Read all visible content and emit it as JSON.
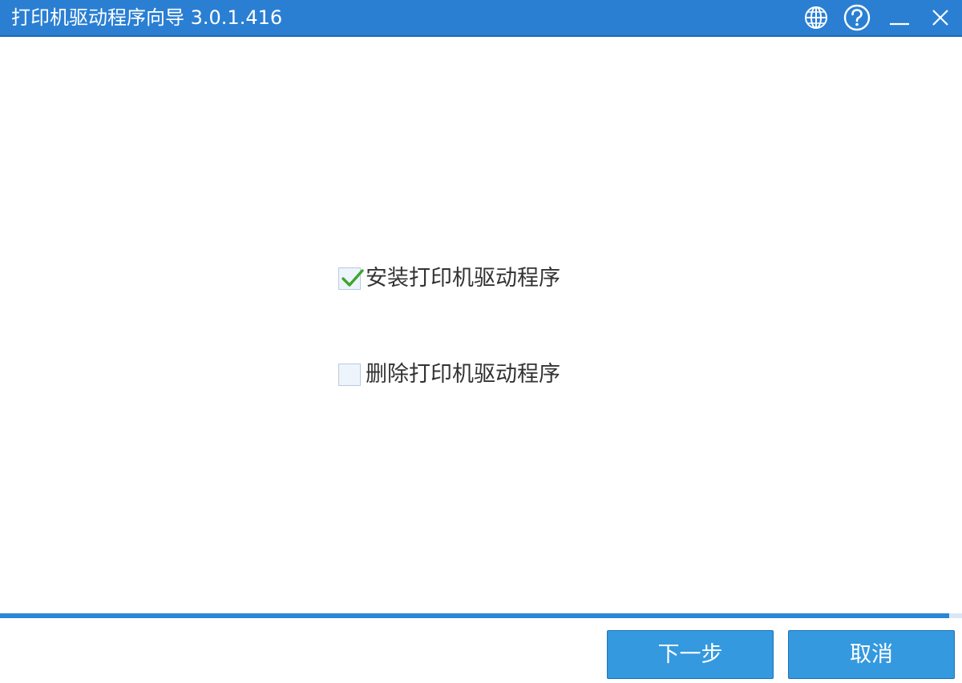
{
  "window": {
    "title": "打印机驱动程序向导  3.0.1.416"
  },
  "titlebar_icons": {
    "language": "globe-icon",
    "help": "question-circle-icon",
    "minimize": "minimize-icon",
    "close": "close-icon"
  },
  "options": [
    {
      "label": "安装打印机驱动程序",
      "checked": true
    },
    {
      "label": "删除打印机驱动程序",
      "checked": false
    }
  ],
  "progress": {
    "value": 0.987
  },
  "buttons": {
    "next": "下一步",
    "cancel": "取消"
  },
  "colors": {
    "titlebar": "#2a7fd3",
    "accent": "#3499df",
    "checkmark": "#3fa42c"
  }
}
